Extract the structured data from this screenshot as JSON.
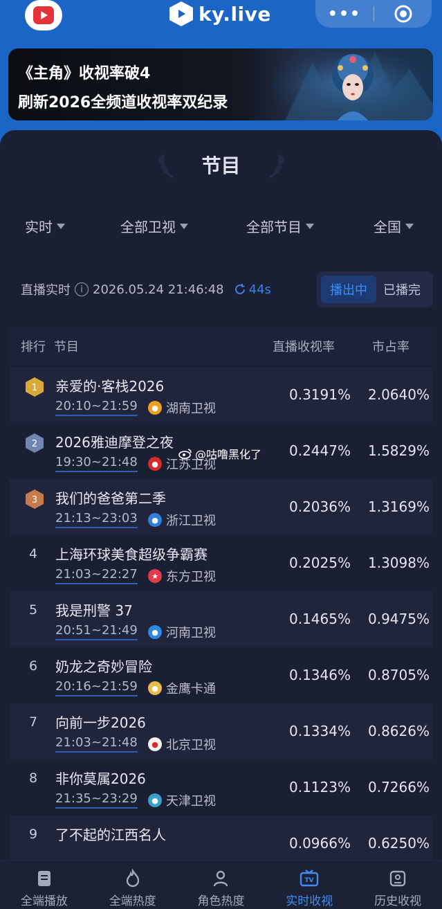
{
  "header": {
    "brand_name": "ky.live",
    "more_icon": "more-dots-icon",
    "close_icon": "target-circle-icon"
  },
  "banner": {
    "line1": "《主角》收视率破4",
    "line2": "刷新2026全频道收视率双纪录"
  },
  "section": {
    "title": "节目"
  },
  "filters": [
    {
      "label": "实时"
    },
    {
      "label": "全部卫视"
    },
    {
      "label": "全部节目"
    },
    {
      "label": "全国"
    }
  ],
  "live": {
    "label": "直播实时",
    "datetime": "2026.05.24 21:46:48",
    "refresh": "44s"
  },
  "toggle": {
    "on": "播出中",
    "off": "已播完"
  },
  "table": {
    "columns": {
      "rank": "排行",
      "program": "节目",
      "rating": "直播收视率",
      "share": "市占率"
    },
    "rows": [
      {
        "rank": "1",
        "name": "亲爱的·客栈2026",
        "time": "20:10~21:59",
        "channel": "湖南卫视",
        "rating": "0.3191%",
        "share": "2.0640%"
      },
      {
        "rank": "2",
        "name": "2026雅迪摩登之夜",
        "time": "19:30~21:48",
        "channel": "江苏卫视",
        "rating": "0.2447%",
        "share": "1.5829%"
      },
      {
        "rank": "3",
        "name": "我们的爸爸第二季",
        "time": "21:13~23:03",
        "channel": "浙江卫视",
        "rating": "0.2036%",
        "share": "1.3169%"
      },
      {
        "rank": "4",
        "name": "上海环球美食超级争霸赛",
        "time": "21:03~22:27",
        "channel": "东方卫视",
        "rating": "0.2025%",
        "share": "1.3098%"
      },
      {
        "rank": "5",
        "name": "我是刑警 37",
        "time": "20:51~21:49",
        "channel": "河南卫视",
        "rating": "0.1465%",
        "share": "0.9475%"
      },
      {
        "rank": "6",
        "name": "奶龙之奇妙冒险",
        "time": "20:16~21:59",
        "channel": "金鹰卡通",
        "rating": "0.1346%",
        "share": "0.8705%"
      },
      {
        "rank": "7",
        "name": "向前一步2026",
        "time": "21:03~21:48",
        "channel": "北京卫视",
        "rating": "0.1334%",
        "share": "0.8626%"
      },
      {
        "rank": "8",
        "name": "非你莫属2026",
        "time": "21:35~23:29",
        "channel": "天津卫视",
        "rating": "0.1123%",
        "share": "0.7266%"
      },
      {
        "rank": "9",
        "name": "了不起的江西名人",
        "time": "",
        "channel": "",
        "rating": "0.0966%",
        "share": "0.6250%"
      }
    ]
  },
  "overlay": {
    "weibo_handle": "@咕噜黑化了"
  },
  "nav": [
    {
      "label": "全端播放",
      "icon": "book-icon"
    },
    {
      "label": "全端热度",
      "icon": "flame-icon"
    },
    {
      "label": "角色热度",
      "icon": "user-icon"
    },
    {
      "label": "实时收视",
      "icon": "tv-icon"
    },
    {
      "label": "历史收视",
      "icon": "history-icon"
    }
  ],
  "colors": {
    "accent": "#3c8ff0",
    "background": "#1b1f33",
    "top_bar": "#1a65c6",
    "gold": "#d9a93a",
    "silver": "#6f86b3",
    "bronze": "#c67b4d"
  }
}
